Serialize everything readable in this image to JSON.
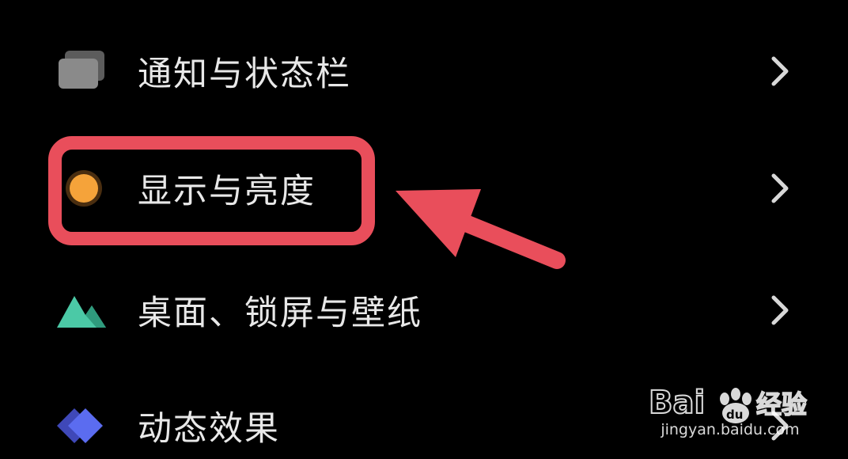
{
  "settings_list": {
    "items": [
      {
        "label": "通知与状态栏",
        "icon": "notification-stack-icon",
        "icon_color": "#8a8a8a"
      },
      {
        "label": "显示与亮度",
        "icon": "brightness-dot-icon",
        "icon_color": "#f5a33a"
      },
      {
        "label": "桌面、锁屏与壁纸",
        "icon": "mountain-wallpaper-icon",
        "icon_color": "#4bc9a6"
      },
      {
        "label": "动态效果",
        "icon": "layered-diamond-icon",
        "icon_color": "#5b6cf0"
      }
    ],
    "chevron_icon": "chevron-right-icon"
  },
  "annotation": {
    "highlight_color": "#e94e5b",
    "highlighted_item": "显示与亮度"
  },
  "watermark": {
    "brand": "Bai du 经验",
    "url": "jingyan.baidu.com"
  }
}
